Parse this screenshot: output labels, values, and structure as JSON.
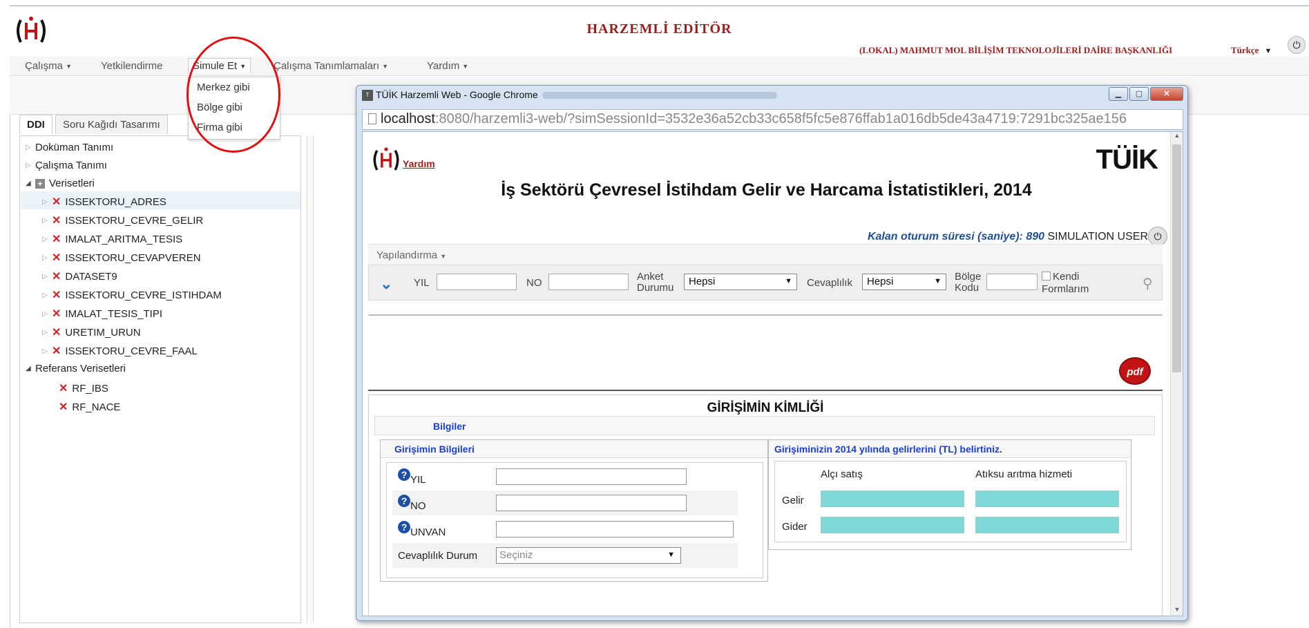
{
  "app": {
    "title": "HARZEMLİ EDİTÖR",
    "org": "(LOKAL) MAHMUT MOL BİLİŞİM TEKNOLOJİLERİ DAİRE BAŞKANLIĞI",
    "language": "Türkçe"
  },
  "menu": {
    "items": [
      "Çalışma",
      "Yetkilendirme",
      "Simule Et",
      "Çalışma Tanımlamaları",
      "Yardım"
    ],
    "simule_dropdown": [
      "Merkez gibi",
      "Bölge gibi",
      "Firma gibi"
    ]
  },
  "tabs": [
    "DDI",
    "Soru Kağıdı Tasarımı"
  ],
  "tree": {
    "doc": "Doküman Tanımı",
    "study": "Çalışma Tanımı",
    "datasets": "Verisetleri",
    "dataset_items": [
      "ISSEKTORU_ADRES",
      "ISSEKTORU_CEVRE_GELIR",
      "IMALAT_ARITMA_TESIS",
      "ISSEKTORU_CEVAPVEREN",
      "DATASET9",
      "ISSEKTORU_CEVRE_ISTIHDAM",
      "IMALAT_TESIS_TIPI",
      "URETIM_URUN",
      "ISSEKTORU_CEVRE_FAAL"
    ],
    "ref_datasets": "Referans Verisetleri",
    "ref_items": [
      "RF_IBS",
      "RF_NACE"
    ]
  },
  "popup": {
    "window_title": "TÜİK Harzemli Web - Google Chrome",
    "url_host": "localhost",
    "url_path": ":8080/harzemli3-web/?simSessionId=3532e36a52cb33c658f5fc5e876ffab1a016db5de43a4719:7291bc325ae156",
    "help": "Yardım",
    "brand": "TÜİK",
    "survey_title": "İş Sektörü Çevresel İstihdam Gelir ve Harcama İstatistikleri, 2014",
    "session_label": "Kalan oturum süresi (saniye):",
    "session_seconds": "890",
    "session_user": "SIMULATION USER",
    "config_menu": "Yapılandırma",
    "filters": {
      "yil": "YIL",
      "no": "NO",
      "anket_line1": "Anket",
      "anket_line2": "Durumu",
      "anket_value": "Hepsi",
      "cevap_label": "Cevaplılık",
      "cevap_value": "Hepsi",
      "bolge_line1": "Bölge",
      "bolge_line2": "Kodu",
      "kendi_line1": "Kendi",
      "kendi_line2": "Formlarım"
    },
    "pdf_label": "pdf",
    "form_title": "GİRİŞİMİN KİMLİĞİ",
    "section": "Bilgiler",
    "left_panel": {
      "title": "Girişimin Bilgileri",
      "rows": [
        "YIL",
        "NO",
        "UNVAN"
      ],
      "cevap_label": "Cevaplılık Durum",
      "cevap_placeholder": "Seçiniz"
    },
    "right_panel": {
      "title": "Girişiminizin 2014 yılında gelirlerini (TL) belirtiniz.",
      "col1": "Alçı satış",
      "col2": "Atıksu arıtma hizmeti",
      "row1": "Gelir",
      "row2": "Gider"
    }
  },
  "colors": {
    "brand": "#9c1c1c",
    "link_blue": "#1a3fd0",
    "cell": "#7fd9d9",
    "annotation": "#e01010"
  }
}
